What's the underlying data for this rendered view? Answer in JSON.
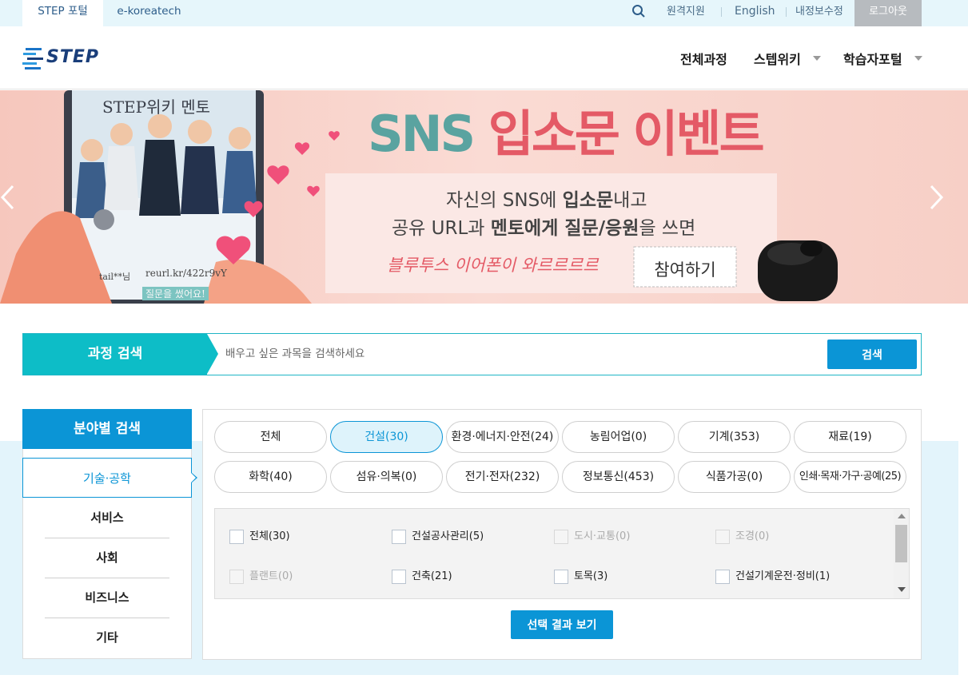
{
  "topbar": {
    "tabs": [
      "STEP 포털",
      "e-koreatech"
    ],
    "search_icon": "search-icon",
    "links": [
      "원격지원",
      "English",
      "내정보수정"
    ],
    "logout": "로그아웃"
  },
  "header": {
    "logo_text": "STEP",
    "nav": [
      "전체과정",
      "스텝위키",
      "학습자포털"
    ]
  },
  "banner": {
    "title_sns": "SNS",
    "title_rest": "입소문 이벤트",
    "line1_a": "자신의 SNS에 ",
    "line1_b": "입소문",
    "line1_c": "내고",
    "line2_a": "공유 URL과 ",
    "line2_b": "멘토에게 질문/응원",
    "line2_c": "을 쓰면",
    "prize": "블루투스 이어폰이 와르르르르",
    "cta": "참여하기",
    "phone_title": "STEP위키 멘토",
    "phone_user": "tail**님",
    "phone_url": "reurl.kr/422r9vY",
    "phone_note": "질문을 썼어요!",
    "prev_icon": "chevron-left-icon",
    "next_icon": "chevron-right-icon"
  },
  "course_search": {
    "label": "과정 검색",
    "placeholder": "배우고 싶은 과목을 검색하세요",
    "button": "검색"
  },
  "field_search": {
    "title": "분야별 검색",
    "categories": [
      "기술·공학",
      "서비스",
      "사회",
      "비즈니스",
      "기타"
    ],
    "pills": [
      "전체",
      "건설(30)",
      "환경·에너지·안전(24)",
      "농림어업(0)",
      "기계(353)",
      "재료(19)",
      "화학(40)",
      "섬유·의복(0)",
      "전기·전자(232)",
      "정보통신(453)",
      "식품가공(0)",
      "인쇄·목재·가구·공예(25)"
    ],
    "subitems": [
      "전체(30)",
      "건설공사관리(5)",
      "도시·교통(0)",
      "조경(0)",
      "플랜트(0)",
      "건축(21)",
      "토목(3)",
      "건설기계운전·정비(1)"
    ],
    "result_button": "선택 결과 보기"
  },
  "colors": {
    "primary_blue": "#0b95d6",
    "teal": "#0dbdc7",
    "banner_bg": "#f8cfc8",
    "banner_teal_text": "#5aa3a0",
    "banner_red_text": "#e45a66"
  }
}
